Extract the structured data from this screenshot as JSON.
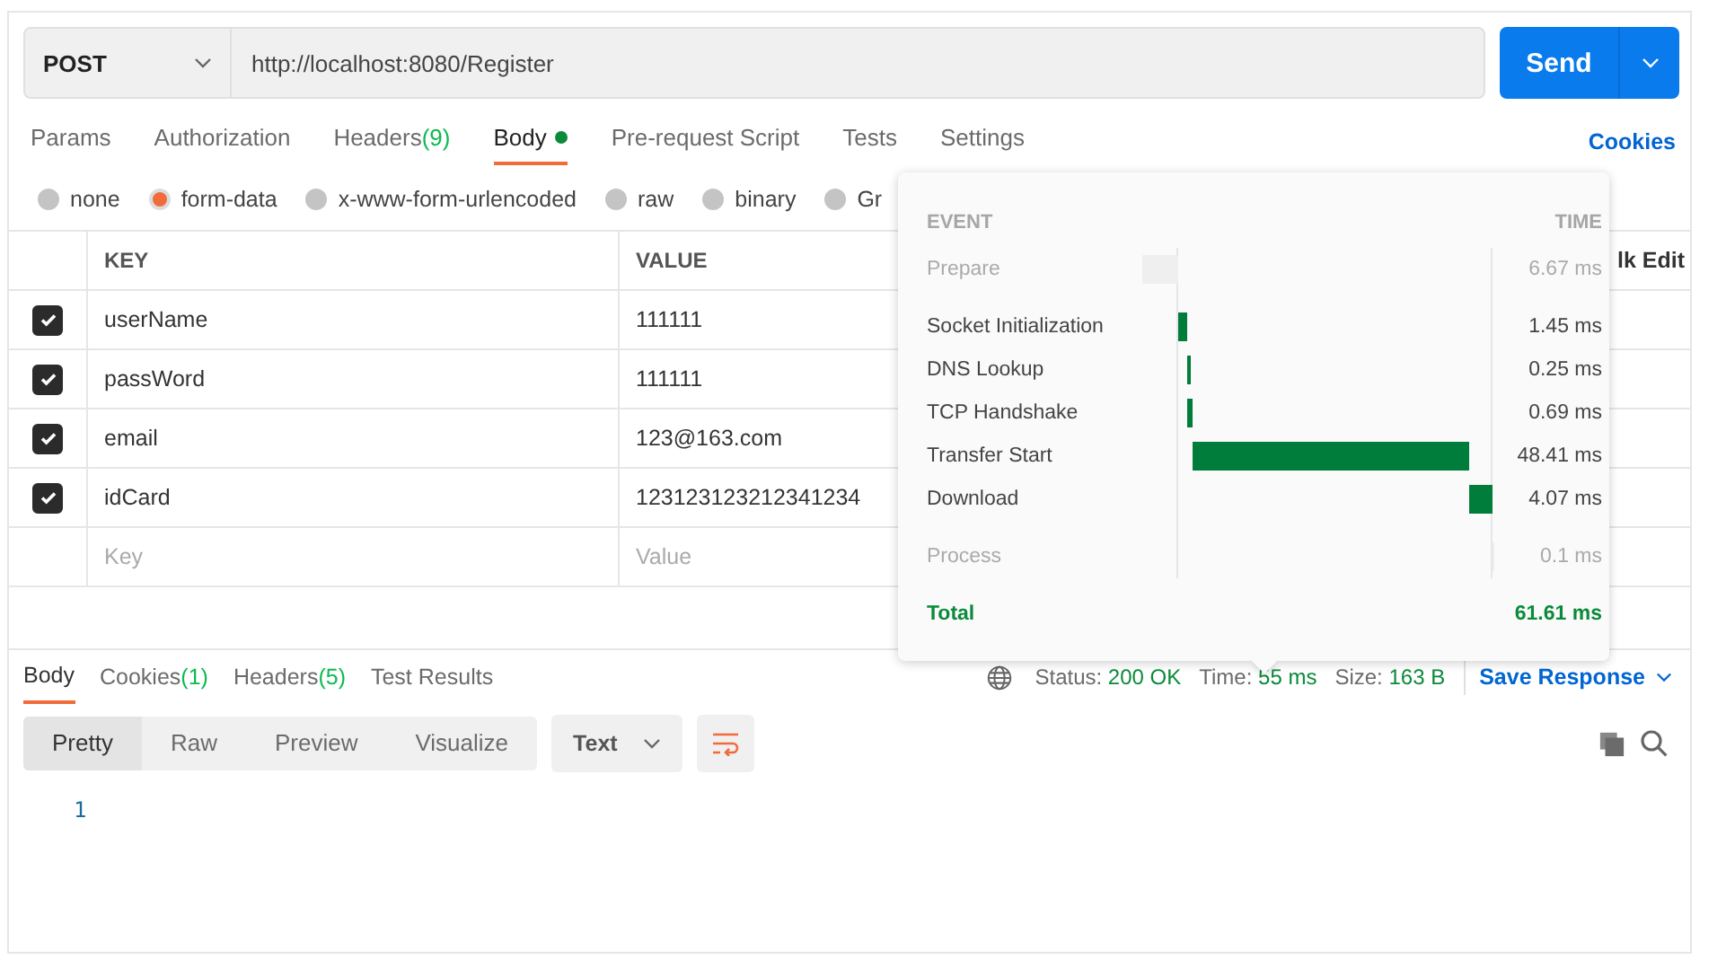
{
  "request": {
    "method": "POST",
    "url": "http://localhost:8080/Register",
    "send_label": "Send"
  },
  "request_tabs": [
    {
      "label": "Params",
      "selected": false
    },
    {
      "label": "Authorization",
      "selected": false
    },
    {
      "label": "Headers",
      "count": "(9)",
      "selected": false
    },
    {
      "label": "Body",
      "dot": true,
      "selected": true
    },
    {
      "label": "Pre-request Script",
      "selected": false
    },
    {
      "label": "Tests",
      "selected": false
    },
    {
      "label": "Settings",
      "selected": false
    }
  ],
  "cookies_link": "Cookies",
  "body_types": [
    {
      "label": "none",
      "selected": false
    },
    {
      "label": "form-data",
      "selected": true
    },
    {
      "label": "x-www-form-urlencoded",
      "selected": false
    },
    {
      "label": "raw",
      "selected": false
    },
    {
      "label": "binary",
      "selected": false
    },
    {
      "label": "Gr",
      "selected": false
    }
  ],
  "table": {
    "columns": [
      "KEY",
      "VALUE"
    ],
    "bulk_edit": "lk Edit",
    "rows": [
      {
        "key": "userName",
        "value": "111111",
        "checked": true
      },
      {
        "key": "passWord",
        "value": "111111",
        "checked": true
      },
      {
        "key": "email",
        "value": "123@163.com",
        "checked": true
      },
      {
        "key": "idCard",
        "value": "123123123212341234",
        "checked": true
      }
    ],
    "new_row": {
      "key_placeholder": "Key",
      "value_placeholder": "Value"
    }
  },
  "timing_popup": {
    "event_header": "EVENT",
    "time_header": "TIME",
    "events": [
      {
        "kind": "pre",
        "name": "Prepare",
        "time": "6.67 ms"
      },
      {
        "kind": "phase",
        "name": "Socket Initialization",
        "time": "1.45 ms"
      },
      {
        "kind": "phase",
        "name": "DNS Lookup",
        "time": "0.25 ms"
      },
      {
        "kind": "phase",
        "name": "TCP Handshake",
        "time": "0.69 ms"
      },
      {
        "kind": "phase",
        "name": "Transfer Start",
        "time": "48.41 ms"
      },
      {
        "kind": "phase",
        "name": "Download",
        "time": "4.07 ms"
      },
      {
        "kind": "post",
        "name": "Process",
        "time": "0.1 ms"
      }
    ],
    "total_label": "Total",
    "total_time": "61.61 ms"
  },
  "response_tabs": [
    {
      "label": "Body",
      "selected": true
    },
    {
      "label": "Cookies",
      "count": "(1)",
      "selected": false
    },
    {
      "label": "Headers",
      "count": "(5)",
      "selected": false
    },
    {
      "label": "Test Results",
      "selected": false
    }
  ],
  "response_meta": [
    {
      "label": "Status:",
      "value": "200 OK"
    },
    {
      "label": "Time:",
      "value": "55 ms"
    },
    {
      "label": "Size:",
      "value": "163 B"
    }
  ],
  "save_response": "Save Response",
  "view_modes": [
    {
      "label": "Pretty",
      "selected": true
    },
    {
      "label": "Raw",
      "selected": false
    },
    {
      "label": "Preview",
      "selected": false
    },
    {
      "label": "Visualize",
      "selected": false
    }
  ],
  "format": "Text",
  "line_numbers": [
    "1"
  ]
}
